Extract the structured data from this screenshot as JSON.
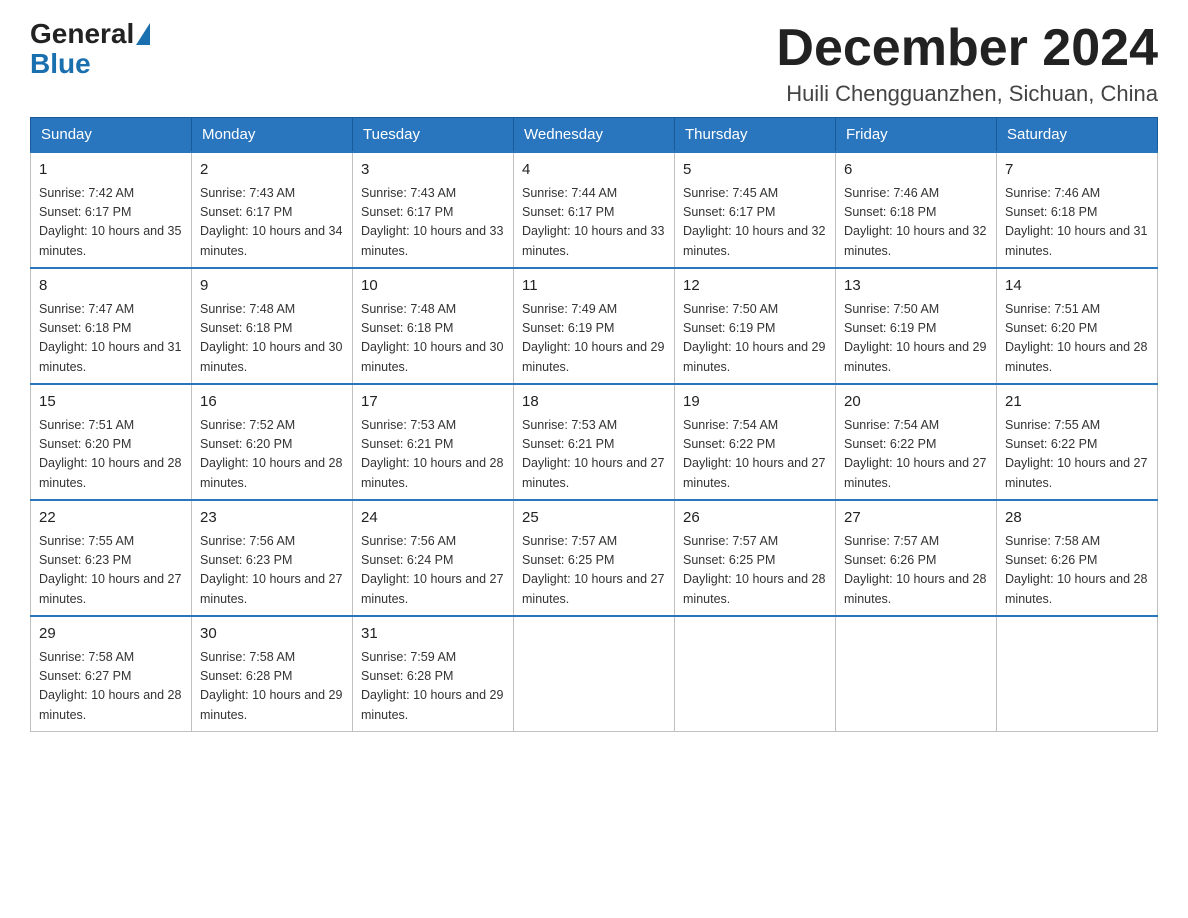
{
  "logo": {
    "general": "General",
    "blue": "Blue"
  },
  "header": {
    "month_year": "December 2024",
    "location": "Huili Chengguanzhen, Sichuan, China"
  },
  "weekdays": [
    "Sunday",
    "Monday",
    "Tuesday",
    "Wednesday",
    "Thursday",
    "Friday",
    "Saturday"
  ],
  "weeks": [
    [
      {
        "day": "1",
        "sunrise": "7:42 AM",
        "sunset": "6:17 PM",
        "daylight": "10 hours and 35 minutes."
      },
      {
        "day": "2",
        "sunrise": "7:43 AM",
        "sunset": "6:17 PM",
        "daylight": "10 hours and 34 minutes."
      },
      {
        "day": "3",
        "sunrise": "7:43 AM",
        "sunset": "6:17 PM",
        "daylight": "10 hours and 33 minutes."
      },
      {
        "day": "4",
        "sunrise": "7:44 AM",
        "sunset": "6:17 PM",
        "daylight": "10 hours and 33 minutes."
      },
      {
        "day": "5",
        "sunrise": "7:45 AM",
        "sunset": "6:17 PM",
        "daylight": "10 hours and 32 minutes."
      },
      {
        "day": "6",
        "sunrise": "7:46 AM",
        "sunset": "6:18 PM",
        "daylight": "10 hours and 32 minutes."
      },
      {
        "day": "7",
        "sunrise": "7:46 AM",
        "sunset": "6:18 PM",
        "daylight": "10 hours and 31 minutes."
      }
    ],
    [
      {
        "day": "8",
        "sunrise": "7:47 AM",
        "sunset": "6:18 PM",
        "daylight": "10 hours and 31 minutes."
      },
      {
        "day": "9",
        "sunrise": "7:48 AM",
        "sunset": "6:18 PM",
        "daylight": "10 hours and 30 minutes."
      },
      {
        "day": "10",
        "sunrise": "7:48 AM",
        "sunset": "6:18 PM",
        "daylight": "10 hours and 30 minutes."
      },
      {
        "day": "11",
        "sunrise": "7:49 AM",
        "sunset": "6:19 PM",
        "daylight": "10 hours and 29 minutes."
      },
      {
        "day": "12",
        "sunrise": "7:50 AM",
        "sunset": "6:19 PM",
        "daylight": "10 hours and 29 minutes."
      },
      {
        "day": "13",
        "sunrise": "7:50 AM",
        "sunset": "6:19 PM",
        "daylight": "10 hours and 29 minutes."
      },
      {
        "day": "14",
        "sunrise": "7:51 AM",
        "sunset": "6:20 PM",
        "daylight": "10 hours and 28 minutes."
      }
    ],
    [
      {
        "day": "15",
        "sunrise": "7:51 AM",
        "sunset": "6:20 PM",
        "daylight": "10 hours and 28 minutes."
      },
      {
        "day": "16",
        "sunrise": "7:52 AM",
        "sunset": "6:20 PM",
        "daylight": "10 hours and 28 minutes."
      },
      {
        "day": "17",
        "sunrise": "7:53 AM",
        "sunset": "6:21 PM",
        "daylight": "10 hours and 28 minutes."
      },
      {
        "day": "18",
        "sunrise": "7:53 AM",
        "sunset": "6:21 PM",
        "daylight": "10 hours and 27 minutes."
      },
      {
        "day": "19",
        "sunrise": "7:54 AM",
        "sunset": "6:22 PM",
        "daylight": "10 hours and 27 minutes."
      },
      {
        "day": "20",
        "sunrise": "7:54 AM",
        "sunset": "6:22 PM",
        "daylight": "10 hours and 27 minutes."
      },
      {
        "day": "21",
        "sunrise": "7:55 AM",
        "sunset": "6:22 PM",
        "daylight": "10 hours and 27 minutes."
      }
    ],
    [
      {
        "day": "22",
        "sunrise": "7:55 AM",
        "sunset": "6:23 PM",
        "daylight": "10 hours and 27 minutes."
      },
      {
        "day": "23",
        "sunrise": "7:56 AM",
        "sunset": "6:23 PM",
        "daylight": "10 hours and 27 minutes."
      },
      {
        "day": "24",
        "sunrise": "7:56 AM",
        "sunset": "6:24 PM",
        "daylight": "10 hours and 27 minutes."
      },
      {
        "day": "25",
        "sunrise": "7:57 AM",
        "sunset": "6:25 PM",
        "daylight": "10 hours and 27 minutes."
      },
      {
        "day": "26",
        "sunrise": "7:57 AM",
        "sunset": "6:25 PM",
        "daylight": "10 hours and 28 minutes."
      },
      {
        "day": "27",
        "sunrise": "7:57 AM",
        "sunset": "6:26 PM",
        "daylight": "10 hours and 28 minutes."
      },
      {
        "day": "28",
        "sunrise": "7:58 AM",
        "sunset": "6:26 PM",
        "daylight": "10 hours and 28 minutes."
      }
    ],
    [
      {
        "day": "29",
        "sunrise": "7:58 AM",
        "sunset": "6:27 PM",
        "daylight": "10 hours and 28 minutes."
      },
      {
        "day": "30",
        "sunrise": "7:58 AM",
        "sunset": "6:28 PM",
        "daylight": "10 hours and 29 minutes."
      },
      {
        "day": "31",
        "sunrise": "7:59 AM",
        "sunset": "6:28 PM",
        "daylight": "10 hours and 29 minutes."
      },
      null,
      null,
      null,
      null
    ]
  ],
  "labels": {
    "sunrise": "Sunrise:",
    "sunset": "Sunset:",
    "daylight": "Daylight:"
  }
}
